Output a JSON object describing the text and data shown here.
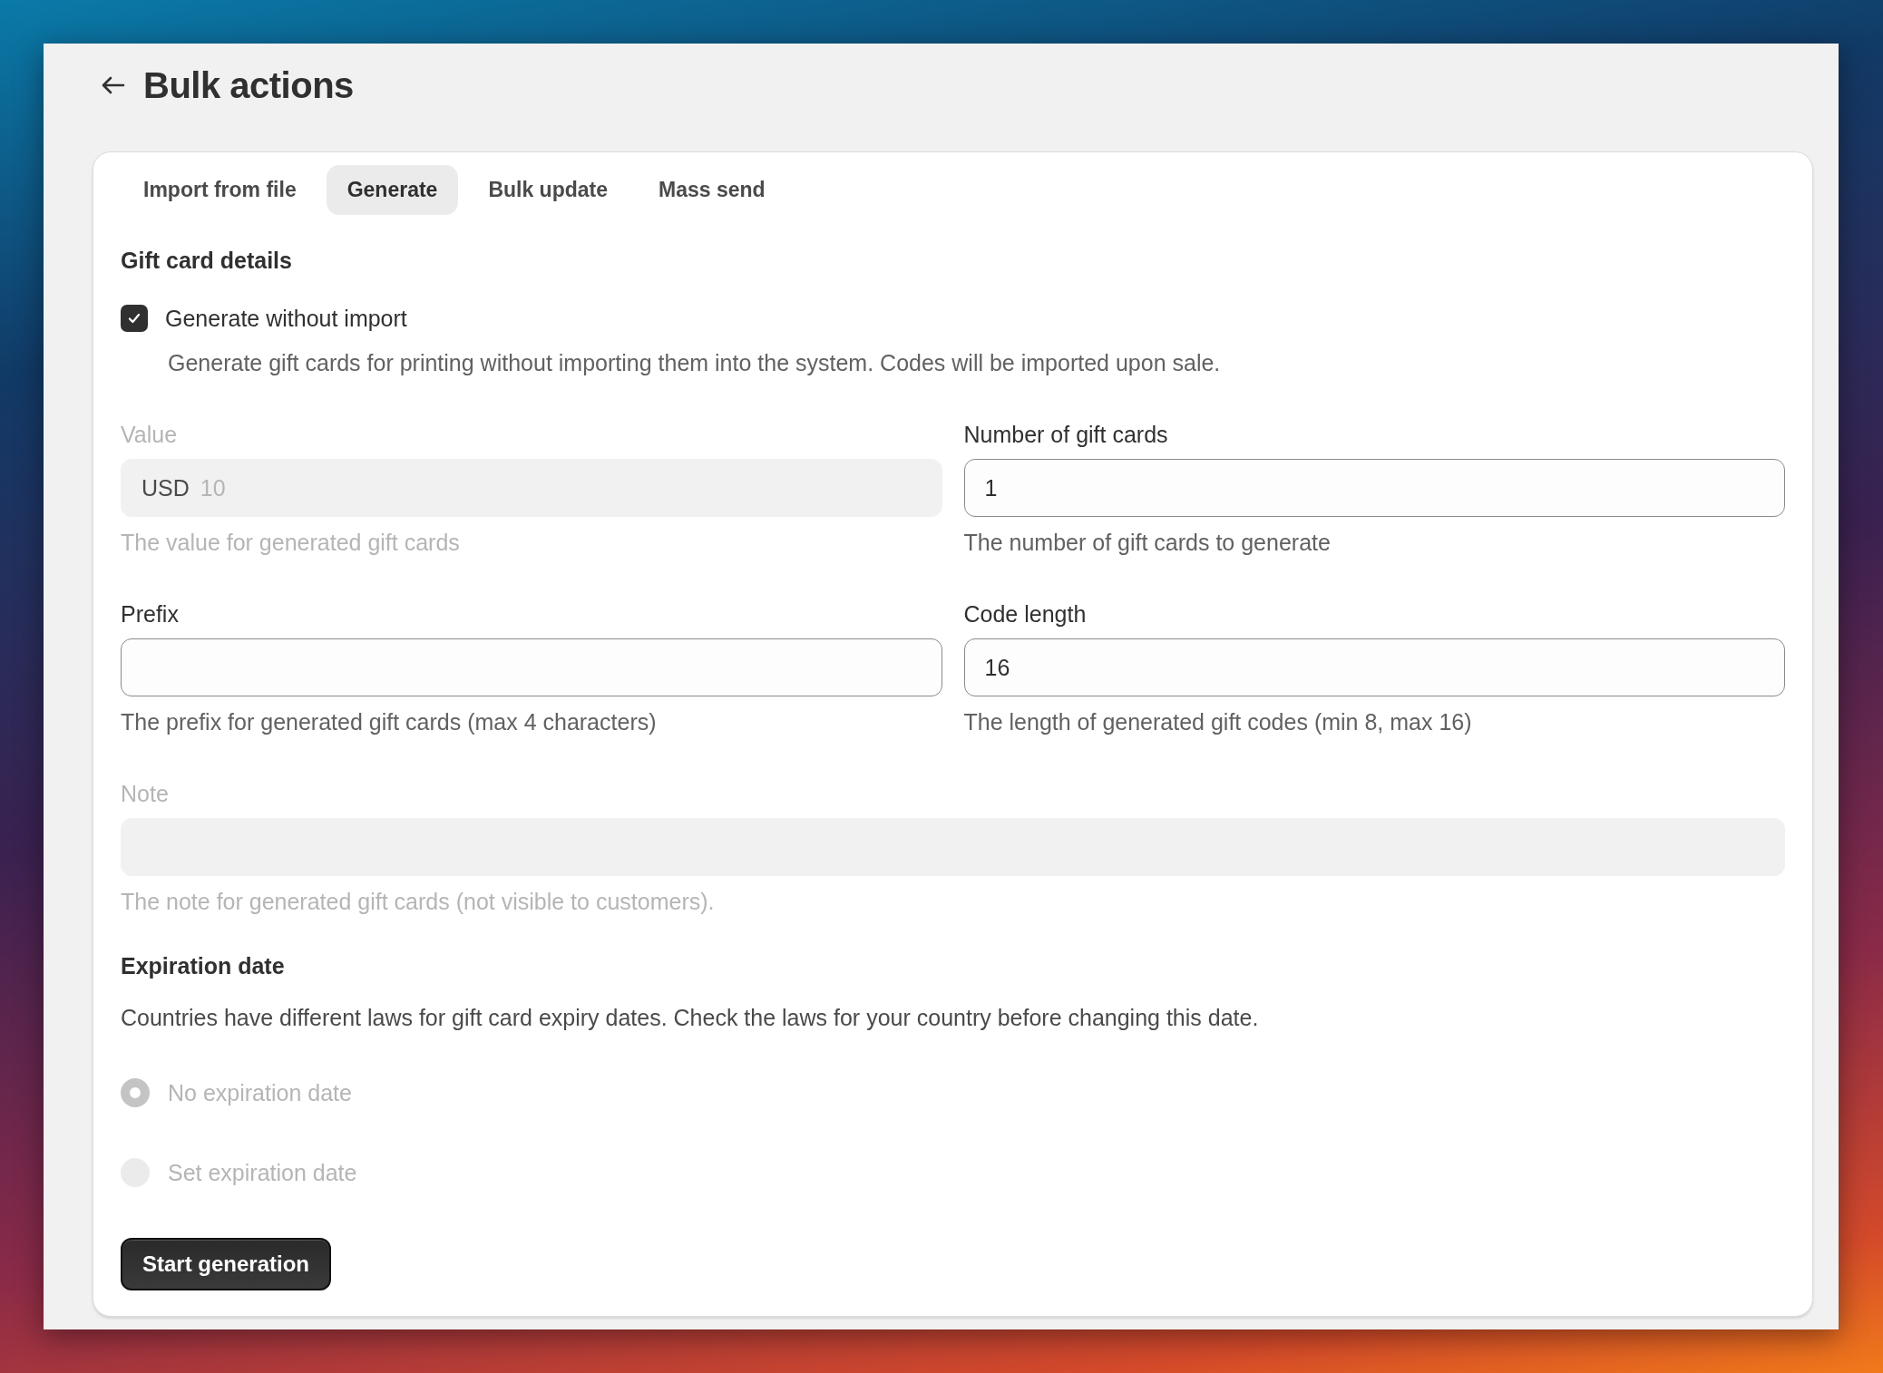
{
  "page": {
    "title": "Bulk actions"
  },
  "tabs": [
    {
      "label": "Import from file",
      "selected": false
    },
    {
      "label": "Generate",
      "selected": true
    },
    {
      "label": "Bulk update",
      "selected": false
    },
    {
      "label": "Mass send",
      "selected": false
    }
  ],
  "details": {
    "heading": "Gift card details",
    "checkbox": {
      "label": "Generate without import",
      "checked": true,
      "description": "Generate gift cards for printing without importing them into the system. Codes will be imported upon sale."
    }
  },
  "field_rows": [
    [
      {
        "label": "Value",
        "prefix": "USD",
        "value": "10",
        "help": "The value for generated gift cards",
        "disabled": true
      },
      {
        "label": "Number of gift cards",
        "value": "1",
        "help": "The number of gift cards to generate",
        "disabled": false
      }
    ],
    [
      {
        "label": "Prefix",
        "help": "The prefix for generated gift cards (max 4 characters)",
        "disabled": false
      },
      {
        "label": "Code length",
        "value": "16",
        "help": "The length of generated gift codes (min 8, max 16)",
        "disabled": false
      }
    ],
    [
      {
        "label": "Note",
        "help": "The note for generated gift cards (not visible to customers).",
        "disabled": true
      }
    ]
  ],
  "expiration": {
    "heading": "Expiration date",
    "description": "Countries have different laws for gift card expiry dates. Check the laws for your country before changing this date.",
    "options": [
      {
        "label": "No expiration date",
        "selected": true,
        "disabled": true
      },
      {
        "label": "Set expiration date",
        "selected": false,
        "disabled": true
      }
    ]
  },
  "button": {
    "label": "Start generation"
  }
}
